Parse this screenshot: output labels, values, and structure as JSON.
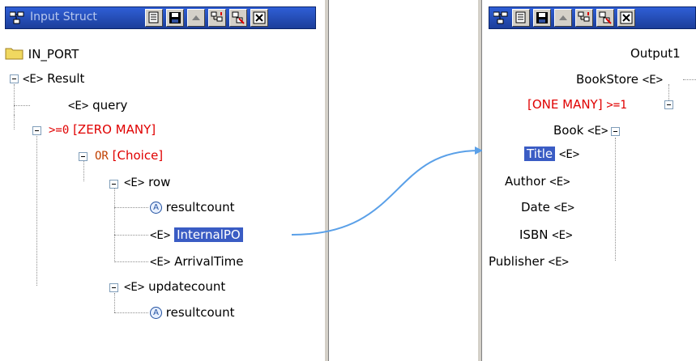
{
  "left_panel": {
    "title": "Input Struct",
    "root": "IN_PORT",
    "nodes": {
      "result": {
        "tag": "<E>",
        "label": "Result"
      },
      "query": {
        "tag": "<E>",
        "label": "query"
      },
      "zero_many": {
        "text": ">=0",
        "label": "[ZERO MANY]"
      },
      "or_choice": {
        "text": "OR",
        "label": "[Choice]"
      },
      "row": {
        "tag": "<E>",
        "label": "row"
      },
      "resultcount1": {
        "tag": "A",
        "label": "resultcount"
      },
      "internalpo": {
        "tag": "<E>",
        "label": "InternalPO"
      },
      "arrivaltime": {
        "tag": "<E>",
        "label": "ArrivalTime"
      },
      "updatecount": {
        "tag": "<E>",
        "label": "updatecount"
      },
      "resultcount2": {
        "tag": "A",
        "label": "resultcount"
      }
    }
  },
  "right_panel": {
    "root": "Output1",
    "nodes": {
      "bookstore": {
        "label": "BookStore",
        "tag": "<E>"
      },
      "one_many": {
        "label": "[ONE MANY]",
        "text": ">=1"
      },
      "book": {
        "label": "Book",
        "tag": "<E>"
      },
      "title": {
        "label": "Title",
        "tag": "<E>"
      },
      "author": {
        "label": "Author",
        "tag": "<E>"
      },
      "date": {
        "label": "Date",
        "tag": "<E>"
      },
      "isbn": {
        "label": "ISBN",
        "tag": "<E>"
      },
      "publisher": {
        "label": "Publisher",
        "tag": "<E>"
      }
    }
  },
  "mapping": {
    "from": "InternalPO",
    "to": "Title",
    "color": "#5aa0e8"
  },
  "colors": {
    "selection": "#3a5cc4",
    "cardinality": "#e00000",
    "titlebar": "#1c3e9a",
    "divider": "#d4d0c8"
  },
  "toolbar_icons": [
    "structure-icon",
    "view-icon",
    "save-icon",
    "up-icon",
    "expand-icon",
    "filter-icon",
    "close-icon"
  ]
}
